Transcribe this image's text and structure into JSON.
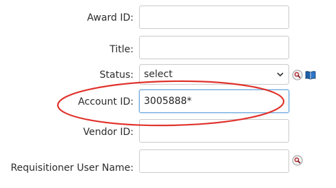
{
  "form": {
    "fields": {
      "award_id": {
        "label": "Award ID:",
        "value": ""
      },
      "title": {
        "label": "Title:",
        "value": ""
      },
      "status": {
        "label": "Status:",
        "selected": "select"
      },
      "account_id": {
        "label": "Account ID:",
        "value": "3005888*"
      },
      "vendor_id": {
        "label": "Vendor ID:",
        "value": ""
      },
      "requisitioner": {
        "label": "Requisitioner User Name:",
        "value": ""
      }
    }
  },
  "icons": {
    "lookup": "magnifier-lookup-icon",
    "book": "book-icon",
    "chevron": "chevron-down-icon"
  },
  "colors": {
    "annotation_ellipse": "#e0322b",
    "focus_border": "#6fa8dc",
    "field_border": "#c9c9c9"
  }
}
